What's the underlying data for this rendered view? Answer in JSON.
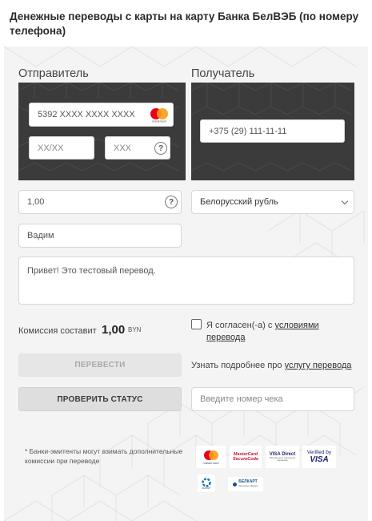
{
  "page": {
    "title": "Денежные переводы с карты на карту Банка БелВЭБ (по номеру телефона)"
  },
  "sender": {
    "label": "Отправитель",
    "card_number": "5392 XXXX  XXXX  XXXX",
    "expiry_placeholder": "XX/XX",
    "cvv_placeholder": "XXX",
    "help_icon": "?",
    "card_logo": "mastercard-logo",
    "card_logo_text": "mastercard"
  },
  "receiver": {
    "label": "Получатель",
    "phone": "+375 (29) 111-11-11"
  },
  "amount": {
    "value": "1,00",
    "help_icon": "?"
  },
  "currency": {
    "selected": "Белорусский рубль"
  },
  "name": {
    "value": "Вадим"
  },
  "message": {
    "value": "Привет! Это тестовый перевод."
  },
  "commission": {
    "label": "Комиссия составит",
    "amount": "1,00",
    "currency": "BYN"
  },
  "agreement": {
    "prefix": "Я согласен(-а) с ",
    "link_line1": "условиями",
    "link_line2": "перевода"
  },
  "actions": {
    "transfer_label": "ПЕРЕВЕСТИ",
    "check_status_label": "ПРОВЕРИТЬ СТАТУС",
    "more_info_prefix": "Узнать подробнее про ",
    "more_info_link": "услугу перевода",
    "check_number_placeholder": "Введите номер чека"
  },
  "footer": {
    "note_line1": "* Банки-эмитенты могут взимать дополнительные",
    "note_line2": "комиссии при переводе",
    "badges": {
      "mastercard": "mastercard",
      "securecode_line1": "MasterCard",
      "securecode_line2": "SecureCode",
      "visa_direct": "VISA Direct",
      "visa_direct_sub": "Мгновенные денежные переводы",
      "verified_line1": "Verified by",
      "verified_line2": "VISA",
      "belkart_small": "БЕЛКАРТ",
      "belkart": "БЕЛКАРТ",
      "belkart_sub": "Интернет-Пароль"
    }
  },
  "colors": {
    "card_bg": "#3b3b3c",
    "panel_bg": "#f4f4f4",
    "mc_red": "#eb001b",
    "mc_orange": "#f79e1b",
    "visa_blue": "#1a1f71"
  }
}
